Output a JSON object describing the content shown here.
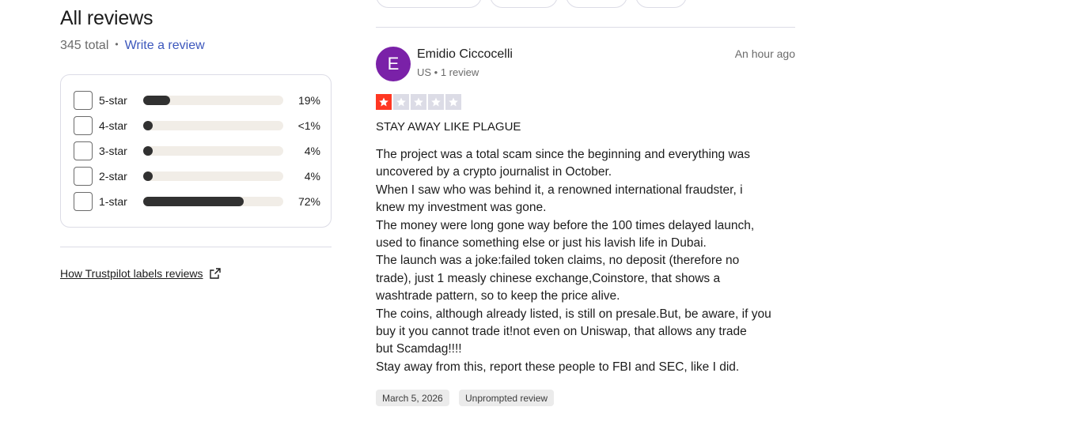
{
  "left": {
    "title": "All reviews",
    "total": "345 total",
    "write_review": "Write a review",
    "ratings": [
      {
        "label": "5-star",
        "percent_text": "19%",
        "fraction": 0.19
      },
      {
        "label": "4-star",
        "percent_text": "<1%",
        "fraction": 0.0
      },
      {
        "label": "3-star",
        "percent_text": "4%",
        "fraction": 0.04
      },
      {
        "label": "2-star",
        "percent_text": "4%",
        "fraction": 0.04
      },
      {
        "label": "1-star",
        "percent_text": "72%",
        "fraction": 0.72
      }
    ],
    "labels_link": "How Trustpilot labels reviews",
    "labels_link_icon": "external-link-icon"
  },
  "review": {
    "avatar_letter": "E",
    "avatar_color": "#7a21a8",
    "author": "Emidio Ciccocelli",
    "meta": "US • 1 review",
    "time": "An hour ago",
    "rating": 1,
    "star_filled_color": "#ff3722",
    "star_empty_color": "#dcdce6",
    "title": "STAY AWAY LIKE PLAGUE",
    "body_lines": [
      "The project was a total scam since the beginning and everything was",
      "uncovered by a crypto journalist in October.",
      "When I saw who was behind it, a renowned international fraudster, i",
      "knew my investment was gone.",
      "The money were long gone way before the 100 times delayed launch,",
      "used to finance something else or just his lavish life in Dubai.",
      "The launch was a joke:failed token claims, no deposit (therefore no",
      "trade), just 1 measly chinese exchange,Coinstore, that shows a",
      "washtrade pattern, so to keep the price alive.",
      "The coins, although already listed, is still on presale.But, be aware, if you",
      "buy it you cannot trade it!not even on Uniswap, that allows any trade",
      "but Scamdag!!!!",
      "Stay away from this, report these people to FBI and SEC, like I did."
    ],
    "date_tag": "March 5, 2026",
    "type_tag": "Unprompted review"
  },
  "colors": {
    "accent_link": "#3c57bc",
    "bar_fill": "#313131",
    "bar_track": "#f1ede7"
  }
}
